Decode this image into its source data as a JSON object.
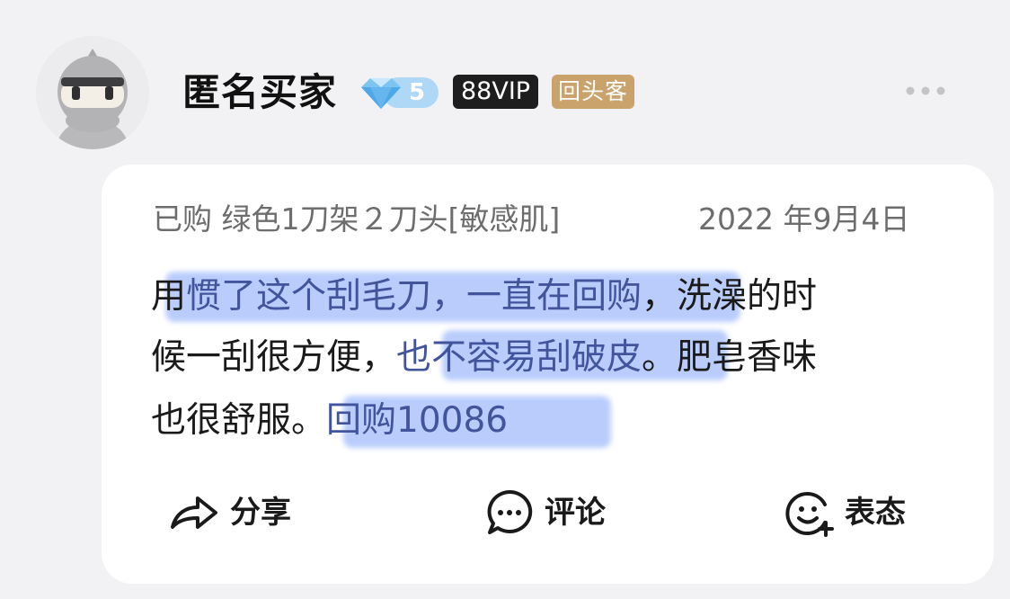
{
  "user": {
    "name": "匿名买家",
    "level": "5",
    "vip_badge": "88VIP",
    "returning_badge": "回头客"
  },
  "review": {
    "purchase_label": "已购",
    "variant": "绿色1刀架２刀头[敏感肌]",
    "date": "2022 年9月4日",
    "lines": [
      {
        "before": "用",
        "highlight": "惯了这个刮毛刀，一直在回购",
        "after": "，洗澡的时"
      },
      {
        "before": "候一刮很方便，",
        "highlight": "也不容易刮破皮",
        "after": "。肥皂香味"
      },
      {
        "before": "也很舒服。",
        "highlight": "回购10086",
        "after": ""
      }
    ]
  },
  "actions": {
    "share": "分享",
    "comment": "评论",
    "react": "表态"
  },
  "colors": {
    "highlight": "#b6cafc",
    "diamond": "#7ec4f2",
    "vip_badge_bg": "#1e1e1e",
    "returning_badge_bg": "#caa36c"
  }
}
